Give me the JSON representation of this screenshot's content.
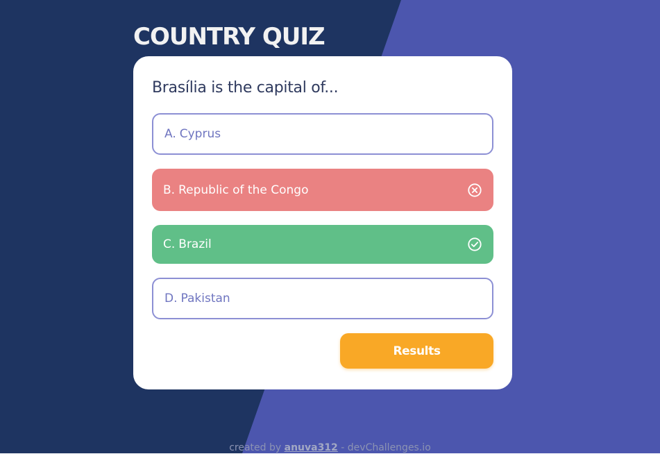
{
  "app": {
    "title": "COUNTRY QUIZ"
  },
  "colors": {
    "background_dark": "#1e3461",
    "background_accent": "#4c56ae",
    "card": "#ffffff",
    "neutral_border": "#8c8fd4",
    "neutral_text": "#6f75c0",
    "wrong": "#ea8282",
    "correct": "#60bf88",
    "results_button": "#f9a826",
    "question_text": "#2f3a5e"
  },
  "quiz": {
    "question": "Brasília is the capital of...",
    "options": [
      {
        "letter": "A.",
        "label": "Cyprus",
        "state": "neutral"
      },
      {
        "letter": "B.",
        "label": "Republic of the Congo",
        "state": "wrong",
        "icon": "x-circle-icon"
      },
      {
        "letter": "C.",
        "label": "Brazil",
        "state": "correct",
        "icon": "check-circle-icon"
      },
      {
        "letter": "D.",
        "label": "Pakistan",
        "state": "neutral"
      }
    ],
    "results_label": "Results"
  },
  "footer": {
    "prefix": "created by",
    "author": "anuva312",
    "separator": "-",
    "site": "devChallenges.io"
  }
}
